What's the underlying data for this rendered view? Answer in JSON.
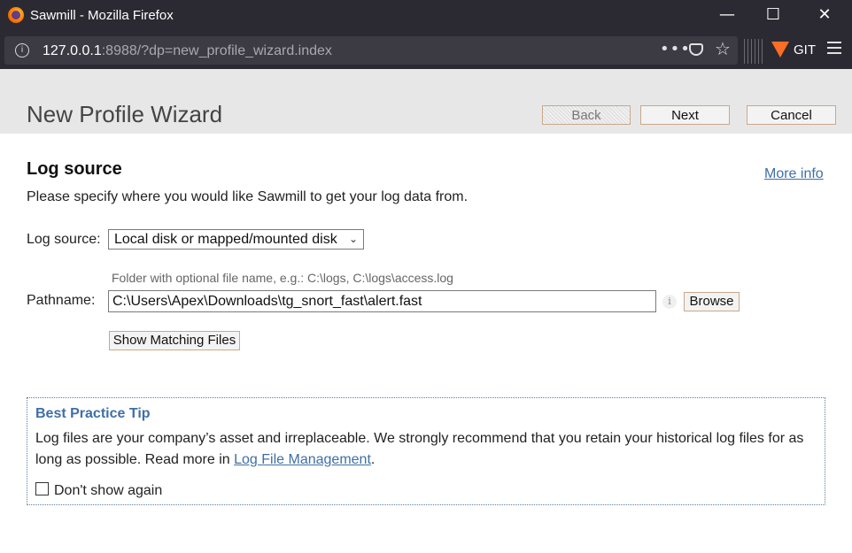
{
  "browser": {
    "window_title": "Sawmill - Mozilla Firefox",
    "minimize_glyph": "—",
    "maximize_glyph": "☐",
    "close_glyph": "✕",
    "url_host": "127.0.0.1",
    "url_rest": ":8988/?dp=new_profile_wizard.index",
    "page_actions_glyph": "•••",
    "star_glyph": "☆",
    "extension_label": "GIT"
  },
  "wizard": {
    "title": "New Profile Wizard",
    "back_label": "Back",
    "next_label": "Next",
    "cancel_label": "Cancel"
  },
  "section": {
    "title": "Log source",
    "more_info": "More info",
    "intro": "Please specify where you would like Sawmill to get your log data from."
  },
  "form": {
    "log_source_label": "Log source:",
    "log_source_value": "Local disk or mapped/mounted disk",
    "path_hint": "Folder with optional file name, e.g.: C:\\logs, C:\\logs\\access.log",
    "pathname_label": "Pathname:",
    "pathname_value": "C:\\Users\\Apex\\Downloads\\tg_snort_fast\\alert.fast",
    "info_glyph": "i",
    "browse_label": "Browse",
    "show_matching_label": "Show Matching Files"
  },
  "tip": {
    "title": "Best Practice Tip",
    "text_before": "Log files are your company’s asset and irreplaceable. We strongly recommend that you retain your historical log files for as long as possible. Read more in ",
    "link": "Log File Management",
    "text_after": ".",
    "checkbox_label": "Don't show again",
    "checkbox_checked": false
  },
  "colors": {
    "browser_chrome": "#2b2a33",
    "header_bg": "#e7e7e7",
    "link": "#3f6fa6",
    "button_border": "#c8a98a"
  }
}
